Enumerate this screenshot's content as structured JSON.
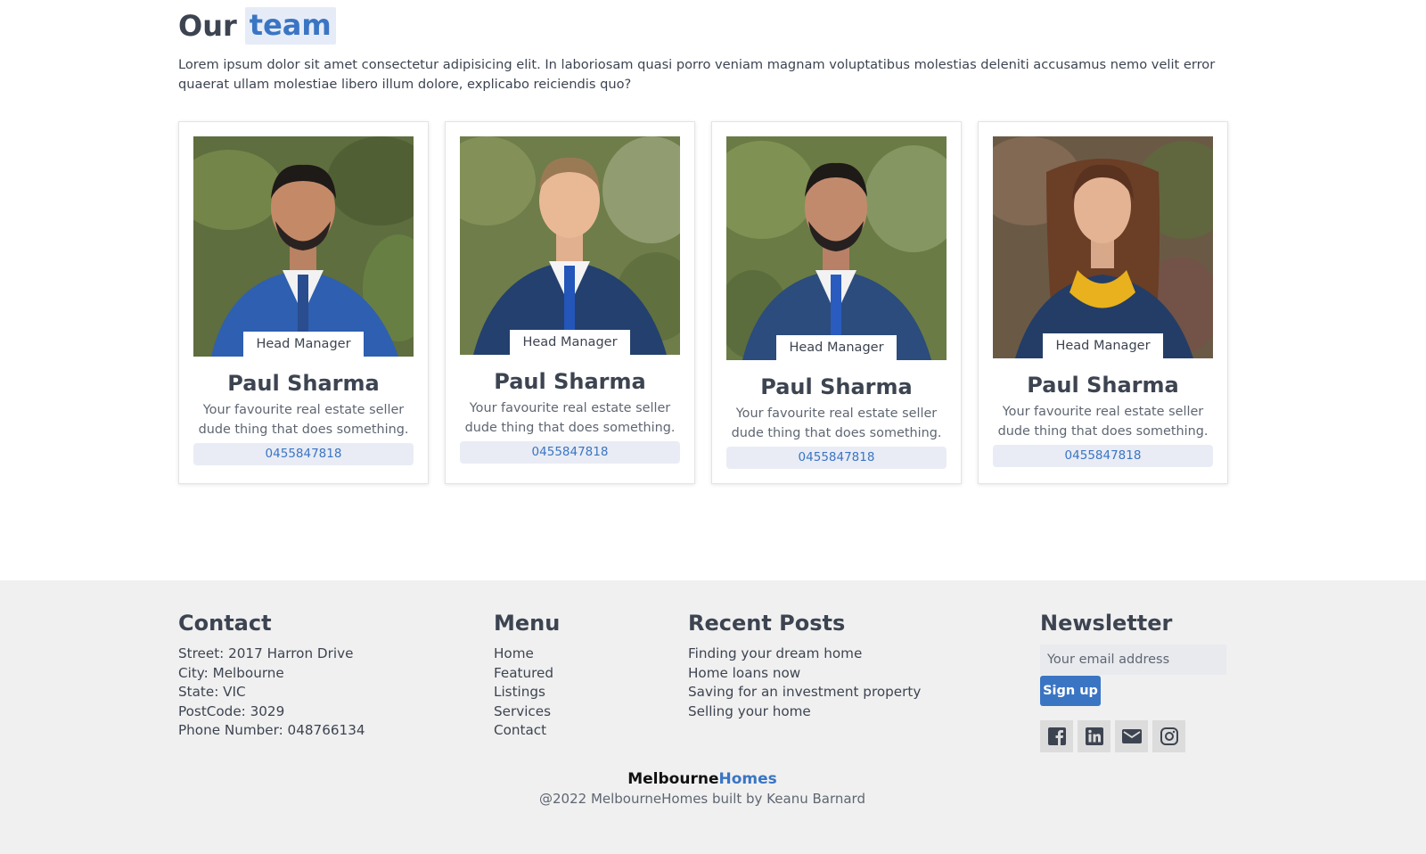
{
  "team": {
    "title_prefix": "Our",
    "title_highlight": "team",
    "description": "Lorem ipsum dolor sit amet consectetur adipisicing elit. In laboriosam quasi porro veniam magnam voluptatibus molestias deleniti accusamus nemo velit error quaerat ullam molestiae libero illum dolore, explicabo reiciendis quo?",
    "members": [
      {
        "role": "Head Manager",
        "name": "Paul Sharma",
        "bio": "Your favourite real estate seller dude thing that does something.",
        "phone": "0455847818"
      },
      {
        "role": "Head Manager",
        "name": "Paul Sharma",
        "bio": "Your favourite real estate seller dude thing that does something.",
        "phone": "0455847818"
      },
      {
        "role": "Head Manager",
        "name": "Paul Sharma",
        "bio": "Your favourite real estate seller dude thing that does something.",
        "phone": "0455847818"
      },
      {
        "role": "Head Manager",
        "name": "Paul Sharma",
        "bio": "Your favourite real estate seller dude thing that does something.",
        "phone": "0455847818"
      }
    ]
  },
  "footer": {
    "contact": {
      "heading": "Contact",
      "lines": [
        "Street: 2017 Harron Drive",
        "City: Melbourne",
        "State: VIC",
        "PostCode: 3029",
        "Phone Number: 048766134"
      ]
    },
    "menu": {
      "heading": "Menu",
      "items": [
        "Home",
        "Featured",
        "Listings",
        "Services",
        "Contact"
      ]
    },
    "recent_posts": {
      "heading": "Recent Posts",
      "items": [
        "Finding your dream home",
        "Home loans now",
        "Saving for an investment property",
        "Selling your home"
      ]
    },
    "newsletter": {
      "heading": "Newsletter",
      "placeholder": "Your email address",
      "button": "Sign up",
      "socials": [
        "facebook-icon",
        "linkedin-icon",
        "mail-icon",
        "instagram-icon"
      ]
    },
    "brand_left": "Melbourne",
    "brand_right": "Homes",
    "copyright": "@2022 MelbourneHomes built by Keanu Barnard"
  },
  "colors": {
    "accent": "#3a75c4",
    "text": "#3d4451",
    "footer_bg": "#f0f0f0",
    "highlight_bg": "#e6ecf7"
  }
}
